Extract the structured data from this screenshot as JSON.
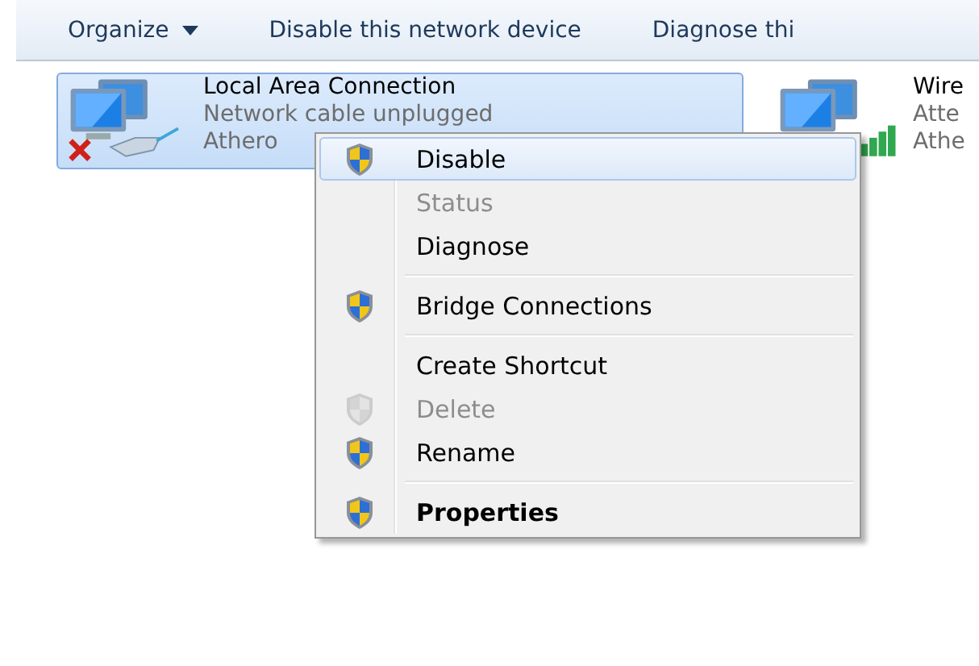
{
  "toolbar": {
    "items": [
      {
        "label": "Organize",
        "dropdown": true
      },
      {
        "label": "Disable this network device",
        "dropdown": false
      },
      {
        "label": "Diagnose thi",
        "dropdown": false
      }
    ]
  },
  "connections": [
    {
      "name": "Local Area Connection",
      "status": "Network cable unplugged",
      "device": "Athero",
      "selected": true,
      "kind": "unplugged"
    },
    {
      "name": "Wire",
      "status": "Atte",
      "device": "Athe",
      "selected": false,
      "kind": "wireless"
    }
  ],
  "context_menu": {
    "groups": [
      {
        "items": [
          {
            "label": "Disable",
            "shield": true,
            "disabled": false,
            "selected": true,
            "default": false
          },
          {
            "label": "Status",
            "shield": false,
            "disabled": true,
            "selected": false,
            "default": false
          },
          {
            "label": "Diagnose",
            "shield": false,
            "disabled": false,
            "selected": false,
            "default": false
          }
        ]
      },
      {
        "items": [
          {
            "label": "Bridge Connections",
            "shield": true,
            "disabled": false,
            "selected": false,
            "default": false
          }
        ]
      },
      {
        "items": [
          {
            "label": "Create Shortcut",
            "shield": false,
            "disabled": false,
            "selected": false,
            "default": false
          },
          {
            "label": "Delete",
            "shield": true,
            "disabled": true,
            "selected": false,
            "default": false
          },
          {
            "label": "Rename",
            "shield": true,
            "disabled": false,
            "selected": false,
            "default": false
          }
        ]
      },
      {
        "items": [
          {
            "label": "Properties",
            "shield": true,
            "disabled": false,
            "selected": false,
            "default": true
          }
        ]
      }
    ]
  }
}
